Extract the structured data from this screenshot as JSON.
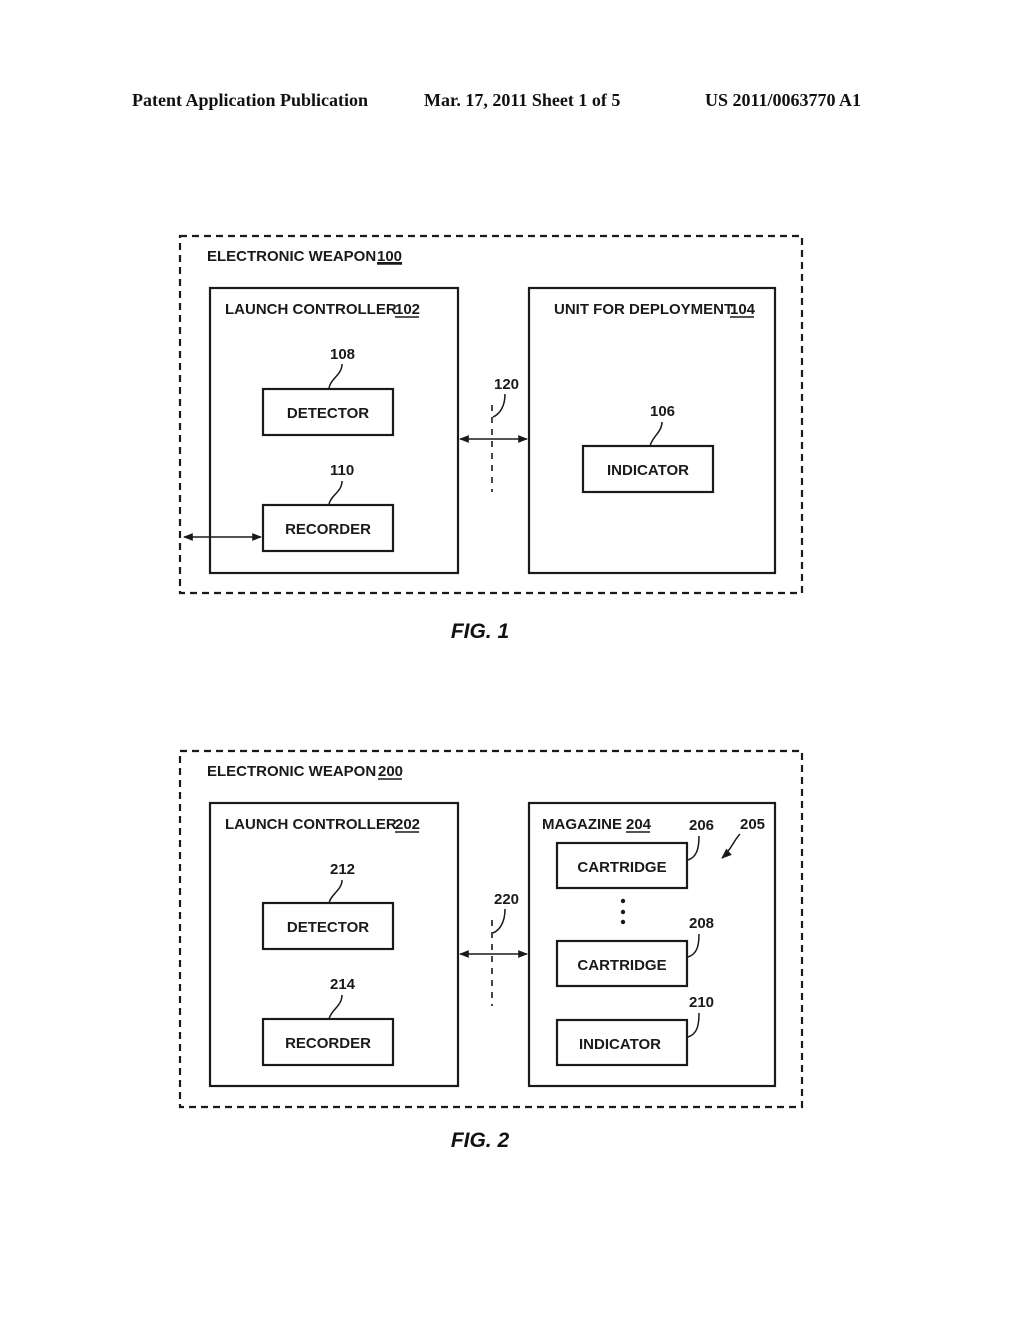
{
  "header": {
    "publication": "Patent Application Publication",
    "date_sheet": "Mar. 17, 2011  Sheet 1 of 5",
    "number": "US 2011/0063770 A1"
  },
  "fig1": {
    "caption": "FIG. 1",
    "outer": {
      "label": "ELECTRONIC WEAPON",
      "ref": "100"
    },
    "launch_controller": {
      "label": "LAUNCH CONTROLLER",
      "ref": "102"
    },
    "detector": {
      "label": "DETECTOR",
      "ref": "108"
    },
    "recorder": {
      "label": "RECORDER",
      "ref": "110"
    },
    "unit": {
      "label": "UNIT FOR DEPLOYMENT",
      "ref": "104"
    },
    "indicator": {
      "label": "INDICATOR",
      "ref": "106"
    },
    "interface_ref": "120"
  },
  "fig2": {
    "caption": "FIG. 2",
    "outer": {
      "label": "ELECTRONIC WEAPON",
      "ref": "200"
    },
    "launch_controller": {
      "label": "LAUNCH CONTROLLER",
      "ref": "202"
    },
    "detector": {
      "label": "DETECTOR",
      "ref": "212"
    },
    "recorder": {
      "label": "RECORDER",
      "ref": "214"
    },
    "magazine": {
      "label": "MAGAZINE",
      "ref": "204"
    },
    "cartridge1": {
      "label": "CARTRIDGE",
      "ref": "206"
    },
    "cartridge2": {
      "label": "CARTRIDGE",
      "ref": "208"
    },
    "indicator": {
      "label": "INDICATOR",
      "ref": "210"
    },
    "cartridge_group_ref": "205",
    "interface_ref": "220"
  }
}
